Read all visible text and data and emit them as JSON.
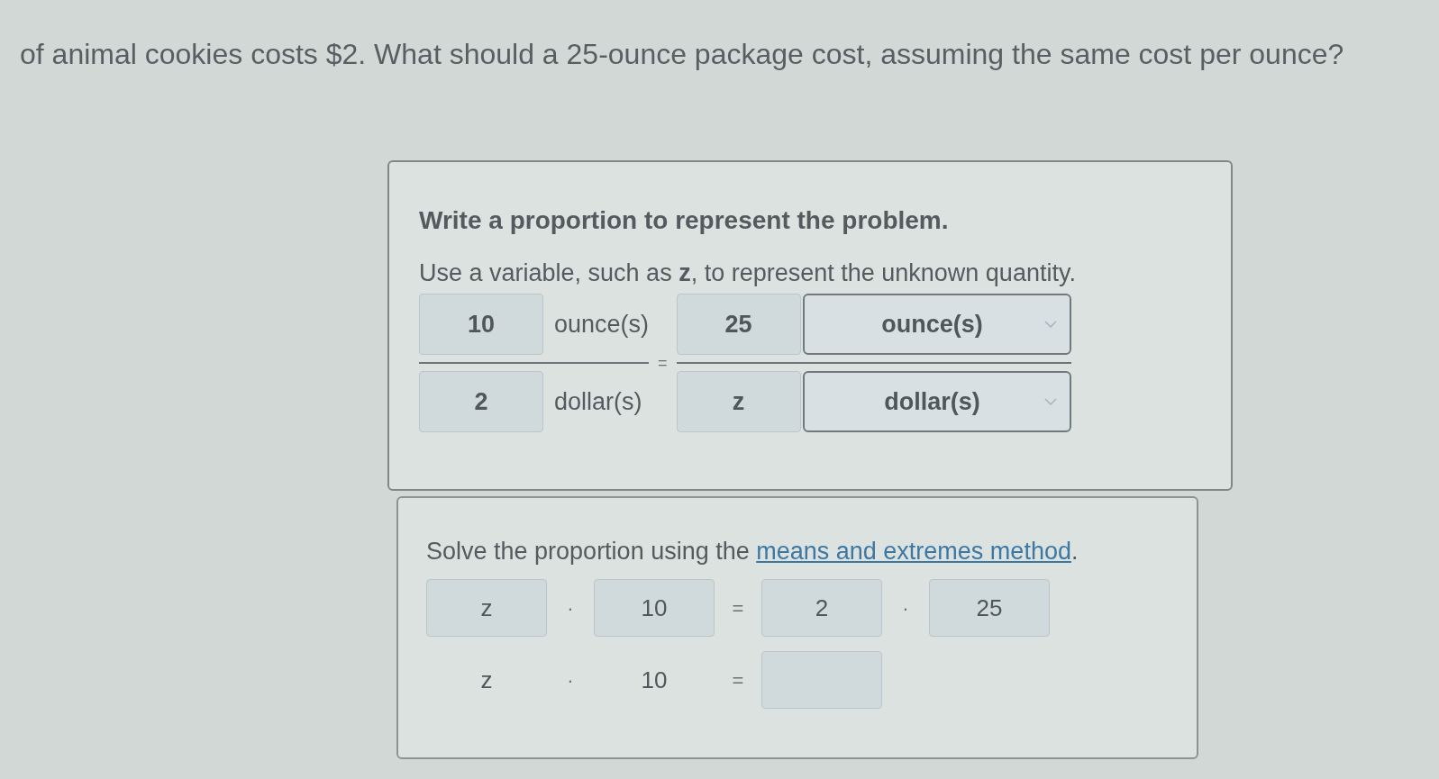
{
  "problem": {
    "text": "of animal cookies costs $2. What should a 25-ounce package cost, assuming the same cost per ounce?"
  },
  "proportion_panel": {
    "heading": "Write a proportion to represent the problem.",
    "instruction": "Use a variable, such as **z**, to represent the unknown quantity.",
    "fractions": [
      {
        "kind": "text",
        "numerator": {
          "value": "10",
          "unit": "ounce(s)"
        },
        "denominator": {
          "value": "2",
          "unit": "dollar(s)"
        }
      },
      {
        "kind": "dropdown",
        "numerator": {
          "value": "25",
          "unit": "ounce(s)"
        },
        "denominator": {
          "value": "z",
          "unit": "dollar(s)"
        }
      }
    ],
    "equals": "="
  },
  "solve_panel": {
    "instruction": {
      "before": "Solve the proportion using the ",
      "link": "means and extremes method",
      "after": "."
    },
    "rows": [
      {
        "terms": [
          {
            "kind": "box",
            "text": "z"
          },
          {
            "kind": "operator",
            "text": "·"
          },
          {
            "kind": "box",
            "text": "10"
          },
          {
            "kind": "operator",
            "text": "="
          },
          {
            "kind": "box",
            "text": "2"
          },
          {
            "kind": "operator",
            "text": "·"
          },
          {
            "kind": "box",
            "text": "25"
          }
        ]
      },
      {
        "terms": [
          {
            "kind": "plain",
            "text": "z"
          },
          {
            "kind": "operator",
            "text": "·"
          },
          {
            "kind": "plain",
            "text": "10"
          },
          {
            "kind": "operator",
            "text": "="
          },
          {
            "kind": "box"
          }
        ]
      }
    ]
  }
}
